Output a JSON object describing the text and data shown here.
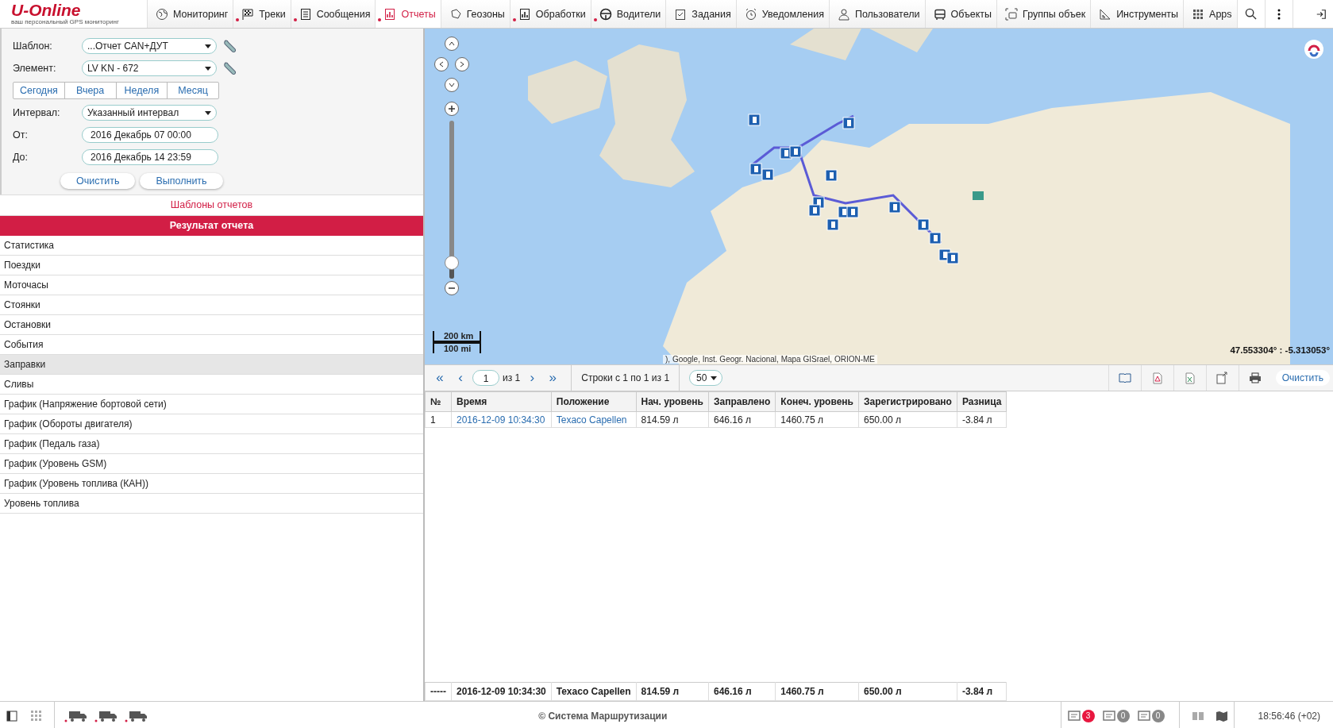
{
  "logo": {
    "name": "U-Online",
    "tagline": "ваш персональный GPS мониторинг"
  },
  "nav": [
    {
      "label": "Мониторинг",
      "marked": false,
      "selected": false
    },
    {
      "label": "Треки",
      "marked": true,
      "selected": false
    },
    {
      "label": "Сообщения",
      "marked": true,
      "selected": false
    },
    {
      "label": "Отчеты",
      "marked": true,
      "selected": true
    },
    {
      "label": "Геозоны",
      "marked": false,
      "selected": false
    },
    {
      "label": "Обработки",
      "marked": true,
      "selected": false
    },
    {
      "label": "Водители",
      "marked": true,
      "selected": false
    },
    {
      "label": "Задания",
      "marked": false,
      "selected": false
    },
    {
      "label": "Уведомления",
      "marked": false,
      "selected": false
    },
    {
      "label": "Пользователи",
      "marked": false,
      "selected": false
    },
    {
      "label": "Объекты",
      "marked": false,
      "selected": false
    },
    {
      "label": "Группы объек",
      "marked": false,
      "selected": false
    },
    {
      "label": "Инструменты",
      "marked": false,
      "selected": false
    },
    {
      "label": "Apps",
      "marked": false,
      "selected": false
    }
  ],
  "form": {
    "fields": [
      {
        "label": "Шаблон:",
        "kind": "select",
        "value": "...Отчет CAN+ДУТ"
      },
      {
        "label": "Элемент:",
        "kind": "select",
        "value": "LV KN - 672"
      }
    ],
    "periods": [
      {
        "label": "Сегодня",
        "selected": false
      },
      {
        "label": "Вчера",
        "selected": false
      },
      {
        "label": "Неделя",
        "selected": false
      },
      {
        "label": "Месяц",
        "selected": false
      }
    ],
    "interval": [
      {
        "label": "Интервал:",
        "kind": "select",
        "value": "Указанный интервал"
      },
      {
        "label": "От:",
        "kind": "input",
        "value": "2016 Декабрь 07 00:00"
      },
      {
        "label": "До:",
        "kind": "input",
        "value": "2016 Декабрь 14 23:59"
      }
    ],
    "buttons": [
      "Очистить",
      "Выполнить"
    ]
  },
  "templates_header": "Шаблоны отчетов",
  "result_header": "Результат отчета",
  "report_items": [
    {
      "label": "Статистика",
      "selected": false
    },
    {
      "label": "Поездки",
      "selected": false
    },
    {
      "label": "Моточасы",
      "selected": false
    },
    {
      "label": "Стоянки",
      "selected": false
    },
    {
      "label": "Остановки",
      "selected": false
    },
    {
      "label": "События",
      "selected": false
    },
    {
      "label": "Заправки",
      "selected": true
    },
    {
      "label": "Сливы",
      "selected": false
    },
    {
      "label": "График (Напряжение бортовой сети)",
      "selected": false
    },
    {
      "label": "График (Обороты двигателя)",
      "selected": false
    },
    {
      "label": "График (Педаль газа)",
      "selected": false
    },
    {
      "label": "График (Уровень GSM)",
      "selected": false
    },
    {
      "label": "График (Уровень топлива (КАН))",
      "selected": false
    },
    {
      "label": "Уровень топлива",
      "selected": false
    }
  ],
  "map": {
    "zoom": {
      "level": 0.1
    },
    "scale": [
      "200 km",
      "100 mi"
    ],
    "attribution": "), Google, Inst. Geogr. Nacional, Mapa GISrael, ORION-ME",
    "coordinates": "47.553304° : -5.313053°"
  },
  "pager": {
    "first": "«",
    "prev": "‹",
    "page": "1",
    "of": "из 1",
    "next": "›",
    "last": "»",
    "rows": "Строки с 1 по 1 из 1",
    "per_page": "50",
    "clear": "Очистить"
  },
  "table": {
    "columns": [
      "№",
      "Время",
      "Положение",
      "Нач. уровень",
      "Заправлено",
      "Конеч. уровень",
      "Зарегистрировано",
      "Разница"
    ],
    "rows": [
      [
        "1",
        "2016-12-09 10:34:30",
        "Texaco Capellen",
        "814.59 л",
        "646.16 л",
        "1460.75 л",
        "650.00 л",
        "-3.84 л"
      ]
    ],
    "total": [
      "-----",
      "2016-12-09 10:34:30",
      "Texaco Capellen",
      "814.59 л",
      "646.16 л",
      "1460.75 л",
      "650.00 л",
      "-3.84 л"
    ]
  },
  "status_bar": {
    "copyright": "© Система Маршрутизации",
    "counters": [
      {
        "count": "3",
        "color": "#e8173f"
      },
      {
        "count": "0",
        "color": "#888888"
      },
      {
        "count": "0",
        "color": "#888888"
      }
    ],
    "time": "18:56:46 (+02)"
  }
}
